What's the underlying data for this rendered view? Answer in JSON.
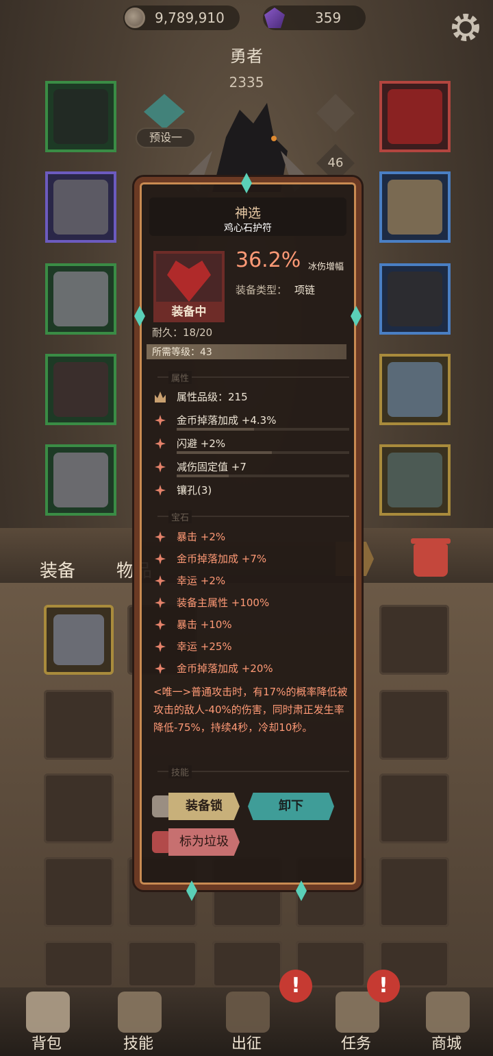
{
  "currency": {
    "gold": "9,789,910",
    "gems": "359",
    "gold_icon": "coin-icon",
    "gem_icon": "purple-crystal-icon"
  },
  "hero": {
    "name": "勇者",
    "power": "2335",
    "preset_label": "预设一",
    "level": "46"
  },
  "tabs": {
    "equipment": "装备",
    "items": "物品"
  },
  "tooltip": {
    "title": "神选",
    "subtitle": "鸡心石护符",
    "main_stat_value": "36.2%",
    "main_stat_name": "冰伤增幅",
    "equip_type_label": "装备类型：",
    "equip_type_value": "项链",
    "equip_state": "装备中",
    "durability": "耐久：18/20",
    "required_level": "所需等级：43",
    "attr_section": "属性",
    "attr_grade": "属性品级：215",
    "attributes": [
      {
        "text": "金币掉落加成 +4.3%",
        "fill": 0.45
      },
      {
        "text": "闪避 +2%",
        "fill": 0.55
      },
      {
        "text": "减伤固定值 +7",
        "fill": 0.3
      },
      {
        "text": "镶孔(3)",
        "fill": 0
      }
    ],
    "gem_section": "宝石",
    "gems": [
      "暴击 +2%",
      "金币掉落加成 +7%",
      "幸运 +2%",
      "装备主属性 +100%",
      "暴击 +10%",
      "幸运 +25%",
      "金币掉落加成 +20%"
    ],
    "unique_text": "<唯一>普通攻击时，有17%的概率降低被攻击的敌人-40%的伤害，同时肃正发生率降低-75%，持续4秒，冷却10秒。",
    "skill_section": "技能",
    "buttons": {
      "lock": "装备锁",
      "unequip": "卸下",
      "junk": "标为垃圾"
    }
  },
  "nav": [
    "背包",
    "技能",
    "出征",
    "任务",
    "商城"
  ],
  "colors": {
    "accent_red": "#ff9a76",
    "teal": "#3f9d98",
    "frame_brown": "#6b3a24"
  }
}
